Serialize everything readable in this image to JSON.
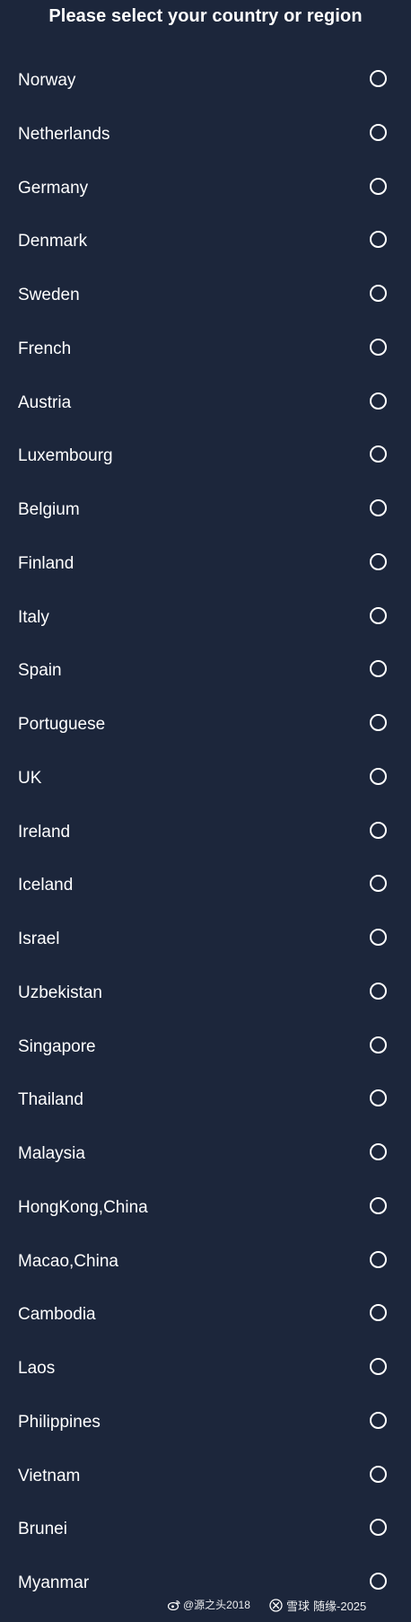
{
  "header": {
    "title": "Please select your country or region"
  },
  "regions": [
    "Norway",
    "Netherlands",
    "Germany",
    "Denmark",
    "Sweden",
    "French",
    "Austria",
    "Luxembourg",
    "Belgium",
    "Finland",
    "Italy",
    "Spain",
    "Portuguese",
    "UK",
    "Ireland",
    "Iceland",
    "Israel",
    "Uzbekistan",
    "Singapore",
    "Thailand",
    "Malaysia",
    "HongKong,China",
    "Macao,China",
    "Cambodia",
    "Laos",
    "Philippines",
    "Vietnam",
    "Brunei",
    "Myanmar"
  ],
  "watermark": {
    "weibo_text": "@源之头2018",
    "xueqiu_brand": "雪球",
    "xueqiu_user": "随缘-2025"
  },
  "colors": {
    "background": "#1c263b",
    "text": "#ffffff"
  }
}
